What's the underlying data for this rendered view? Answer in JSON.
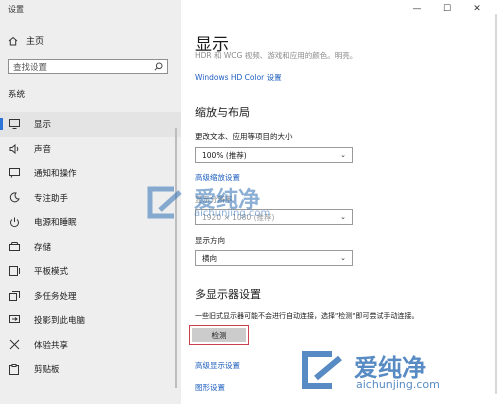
{
  "app": {
    "title": "设置"
  },
  "window_controls": [
    "—",
    "☐",
    "✕"
  ],
  "sidebar": {
    "home_label": "主页",
    "search_placeholder": "查找设置",
    "section": "系统",
    "items": [
      {
        "label": "显示",
        "icon": "monitor-icon",
        "active": true
      },
      {
        "label": "声音",
        "icon": "speaker-icon"
      },
      {
        "label": "通知和操作",
        "icon": "notification-icon"
      },
      {
        "label": "专注助手",
        "icon": "moon-icon"
      },
      {
        "label": "电源和睡眠",
        "icon": "power-icon"
      },
      {
        "label": "存储",
        "icon": "storage-icon"
      },
      {
        "label": "平板模式",
        "icon": "tablet-icon"
      },
      {
        "label": "多任务处理",
        "icon": "multitask-icon"
      },
      {
        "label": "投影到此电脑",
        "icon": "project-icon"
      },
      {
        "label": "体验共享",
        "icon": "share-icon"
      },
      {
        "label": "剪贴板",
        "icon": "clipboard-icon"
      }
    ]
  },
  "main": {
    "title": "显示",
    "description": "HDR 和 WCG 视频、游戏和应用的颜色。明亮。",
    "hd_color_link": "Windows HD Color 设置",
    "scale_layout": {
      "heading": "缩放与布局",
      "text_size_label": "更改文本、应用等项目的大小",
      "text_size_value": "100% (推荐)",
      "advanced_scaling_link": "高级缩放设置",
      "resolution_label": "显示分辨率",
      "resolution_value": "1920 × 1080 (推荐)",
      "orientation_label": "显示方向",
      "orientation_value": "横向"
    },
    "multi_display": {
      "heading": "多显示器设置",
      "info": "一些旧式显示器可能不会进行自动连接，选择\"检测\"即可尝试手动连接。",
      "detect_button": "检测",
      "advanced_display_link": "高级显示设置",
      "graphics_link": "图形设置"
    }
  },
  "watermark": {
    "name": "爱纯净",
    "url": "aichunjing.com"
  },
  "colors": {
    "accent": "#2c74d6",
    "link": "#1f5fbf",
    "highlight_border": "#c9414f"
  }
}
